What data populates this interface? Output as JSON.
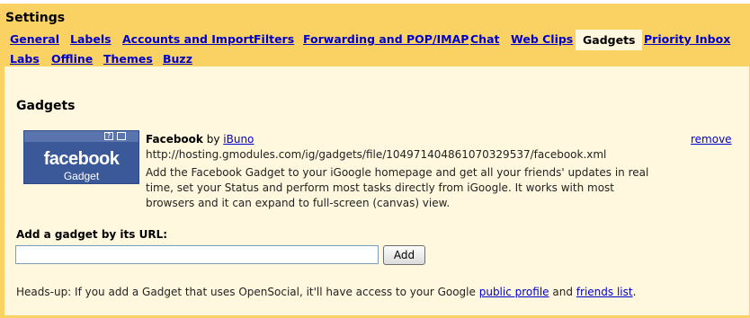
{
  "settings": {
    "title": "Settings"
  },
  "tabs": [
    {
      "label": "General"
    },
    {
      "label": "Labels"
    },
    {
      "label": "Accounts and Import"
    },
    {
      "label": "Filters"
    },
    {
      "label": "Forwarding and POP/IMAP"
    },
    {
      "label": "Chat"
    },
    {
      "label": "Web Clips"
    },
    {
      "label": "Gadgets",
      "active": true
    },
    {
      "label": "Priority Inbox"
    },
    {
      "label": "Labs"
    },
    {
      "label": "Offline"
    },
    {
      "label": "Themes"
    },
    {
      "label": "Buzz"
    }
  ],
  "gadgets_section": {
    "title": "Gadgets",
    "gadget": {
      "thumbnail_logo": "facebook",
      "thumbnail_sub": "Gadget",
      "name": "Facebook",
      "by_word": "by",
      "author": "iBuno",
      "url": "http://hosting.gmodules.com/ig/gadgets/file/104971404861070329537/facebook.xml",
      "description": "Add the Facebook Gadget to your iGoogle homepage and get all your friends' updates in real time, set your Status and perform most tasks directly from iGoogle. It works with most browsers and it can expand to full-screen (canvas) view.",
      "remove_label": "remove"
    },
    "add_by_url": {
      "label": "Add a gadget by its URL:",
      "input_value": "",
      "button_label": "Add"
    },
    "headsup": {
      "prefix": "Heads-up: If you add a Gadget that uses OpenSocial, it'll have access to your Google",
      "link1": "public profile",
      "and": "and",
      "link2": "friends list",
      "suffix": "."
    }
  },
  "colors": {
    "frame": "#fad163",
    "panel": "#fff8de",
    "link": "#0000cc",
    "facebook_blue": "#3b5998"
  }
}
